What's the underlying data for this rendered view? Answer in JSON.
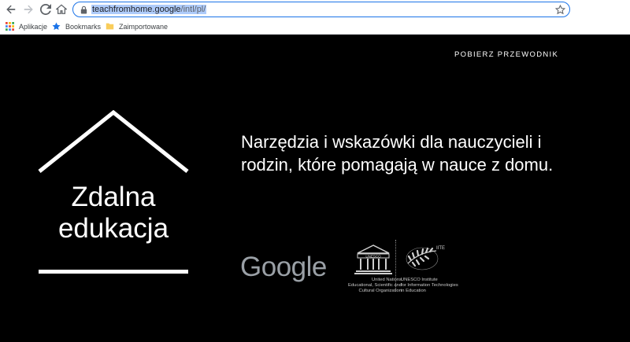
{
  "browser": {
    "url_host": "teachfromhome.google",
    "url_path": "/intl/pl/",
    "bookmarks": [
      {
        "label": "Aplikacje",
        "icon": "apps-grid-icon"
      },
      {
        "label": "Bookmarks",
        "icon": "star-icon"
      },
      {
        "label": "Zaimportowane",
        "icon": "folder-icon"
      }
    ]
  },
  "header": {
    "download_label": "POBIERZ PRZEWODNIK"
  },
  "hero": {
    "logo_line1": "Zdalna",
    "logo_line2": "edukacja",
    "tagline": "Narzędzia i wskazówki dla nauczycieli i rodzin, które pomagają w nauce z domu."
  },
  "partners": {
    "google_label": "Google",
    "unesco_lines": [
      "United Nations",
      "Educational, Scientific and",
      "Cultural Organization"
    ],
    "iite_lines": [
      "UNESCO Institute",
      "for Information Technologies",
      "in Education"
    ]
  },
  "colors": {
    "background": "#000000",
    "text": "#ffffff",
    "google_logo": "#9aa0a6",
    "omnibox_border": "#1a73e8",
    "url_highlight": "#aecbfa"
  }
}
